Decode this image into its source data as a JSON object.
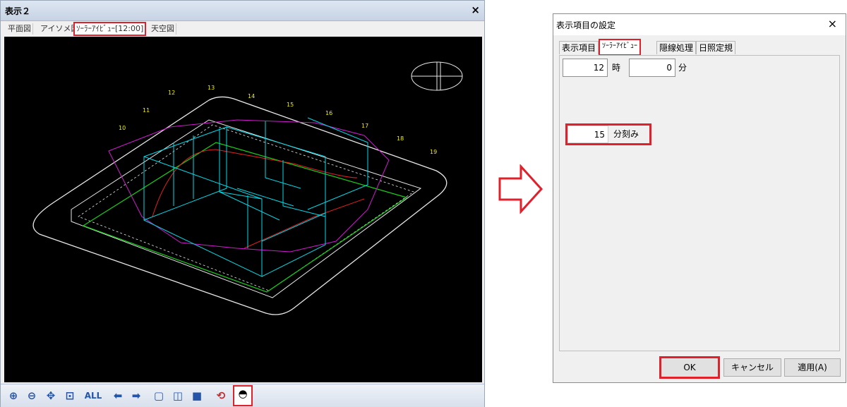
{
  "left_window": {
    "title": "表示２",
    "close_label": "×",
    "tabs": [
      {
        "label": "平面図",
        "active": false
      },
      {
        "label": "アイソメ図",
        "active": false
      },
      {
        "label": "ｿｰﾗｰｱｲﾋﾞｭｰ[12:00]",
        "active": true
      },
      {
        "label": "天空図",
        "active": false
      }
    ],
    "hour_labels": [
      "10",
      "11",
      "12",
      "13",
      "14",
      "15",
      "16",
      "17",
      "18",
      "19"
    ],
    "toolbar": {
      "all_label": "ALL",
      "icons": [
        "zoom-in-icon",
        "zoom-out-icon",
        "pan-icon",
        "fit-window-icon",
        "all-button",
        "arrow-left-icon",
        "arrow-right-icon",
        "cube-front-icon",
        "cube-side-icon",
        "cube-solid-icon",
        "rotate-icon",
        "solar-view-icon"
      ]
    },
    "colors": {
      "building": "#00d8e6",
      "sun_path": "#d01ad0",
      "ground_line": "#18d018",
      "outline": "#e8e8e8",
      "hour_text": "#f0f000",
      "highlight": "#e0202a"
    }
  },
  "dialog": {
    "title": "表示項目の設定",
    "close_label": "×",
    "tabs": [
      {
        "label": "表示項目",
        "active": false
      },
      {
        "label": "ｿｰﾗｰｱｲﾋﾞｭｰ",
        "active": true
      },
      {
        "label": "隠線処理",
        "active": false
      },
      {
        "label": "日照定規",
        "active": false
      }
    ],
    "hour_value": "12",
    "hour_unit": "時",
    "minute_value": "0",
    "minute_unit": "分",
    "step_value": "15",
    "step_unit": "分刻み",
    "buttons": {
      "ok": "OK",
      "cancel": "キャンセル",
      "apply": "適用(A)"
    }
  }
}
